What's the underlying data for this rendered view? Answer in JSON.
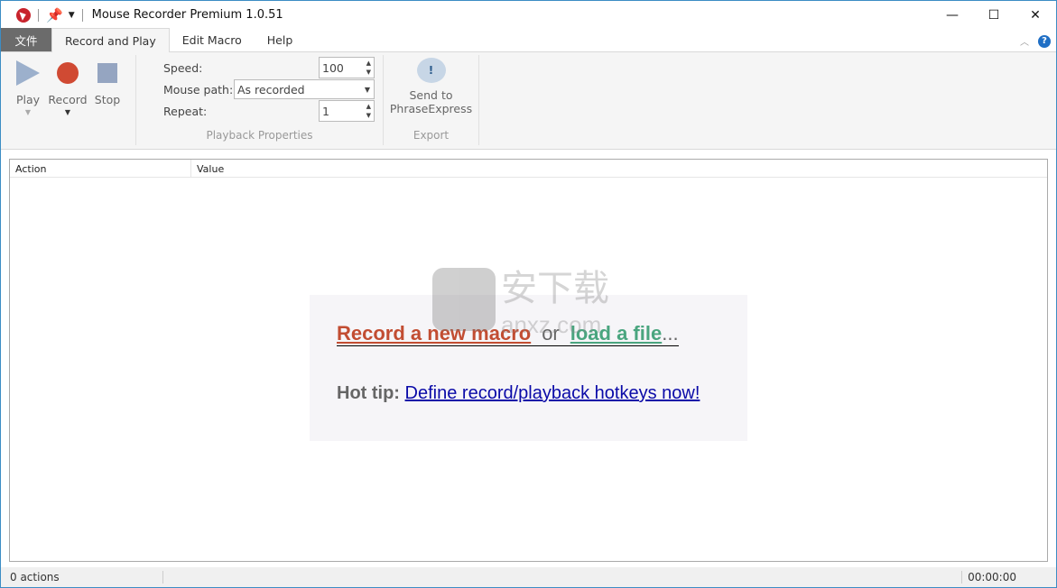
{
  "window": {
    "title": "Mouse Recorder Premium 1.0.51",
    "minimize": "—",
    "maximize": "☐",
    "close": "✕"
  },
  "tabs": [
    {
      "label": "文件"
    },
    {
      "label": "Record and Play"
    },
    {
      "label": "Edit Macro"
    },
    {
      "label": "Help"
    }
  ],
  "ribbon": {
    "play": "Play",
    "record": "Record",
    "stop": "Stop",
    "speed_label": "Speed:",
    "speed_value": "100",
    "mouse_path_label": "Mouse path:",
    "mouse_path_value": "As recorded",
    "repeat_label": "Repeat:",
    "repeat_value": "1",
    "playback_group": "Playback Properties",
    "send_line1": "Send to",
    "send_line2": "PhraseExpress",
    "export_group": "Export"
  },
  "table": {
    "columns": [
      "Action",
      "Value"
    ]
  },
  "welcome": {
    "record": "Record a new macro",
    "or": "or",
    "load": "load a file",
    "dots": "...",
    "hot_tip": "Hot tip:",
    "hotkeys": "Define record/playback hotkeys now!"
  },
  "watermark": {
    "cn": "安下载",
    "site": "anxz.com"
  },
  "status": {
    "actions": "0 actions",
    "time": "00:00:00"
  },
  "colors": {
    "record": "#c24d32",
    "load": "#4aa57f",
    "link": "#0a0aa8"
  }
}
